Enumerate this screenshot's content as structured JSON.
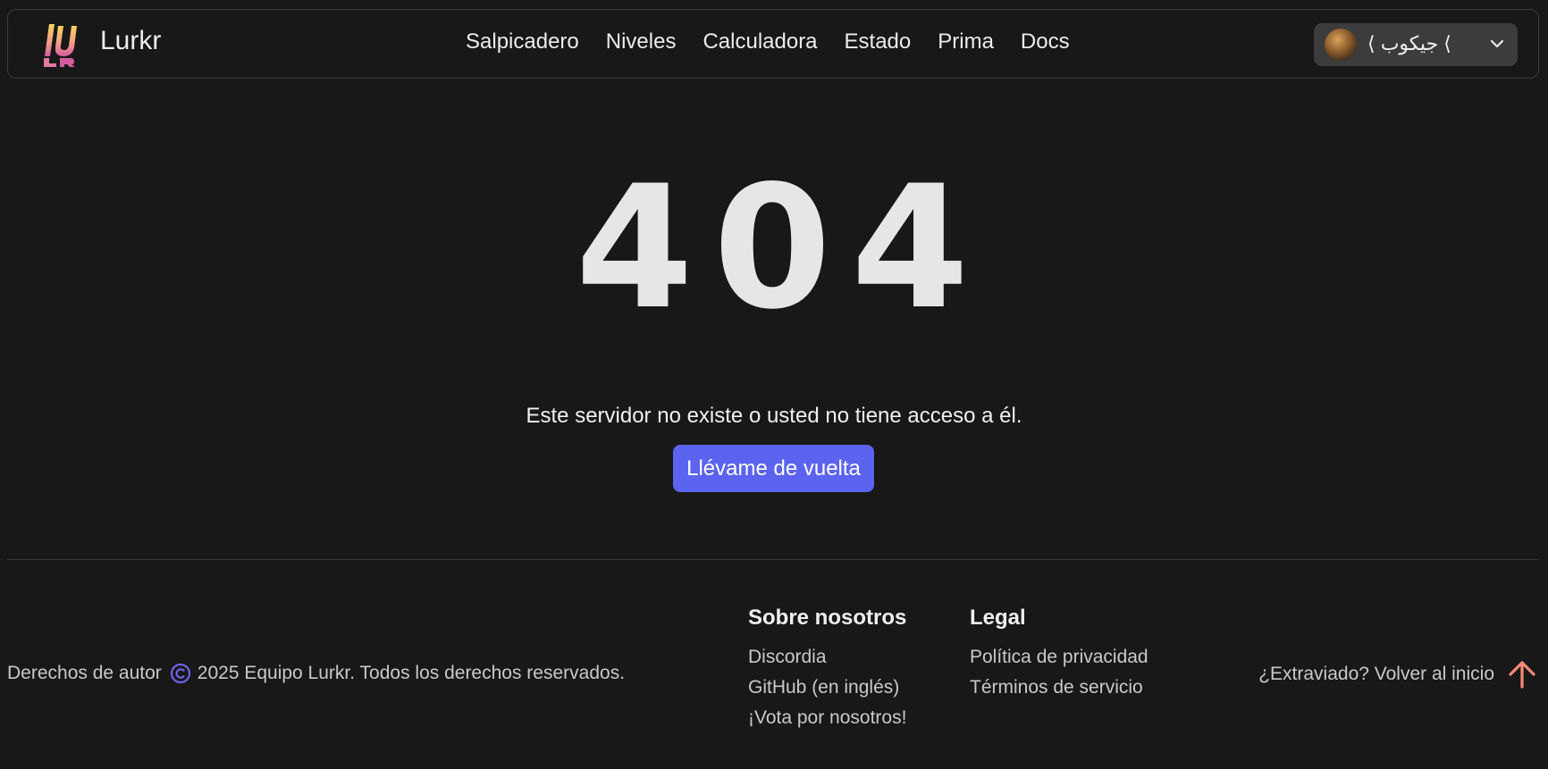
{
  "header": {
    "brand": "Lurkr",
    "nav": [
      "Salpicadero",
      "Niveles",
      "Calculadora",
      "Estado",
      "Prima",
      "Docs"
    ],
    "user": {
      "name": "⟨ جيكوب ⟨",
      "avatar_icon": "user-avatar",
      "menu_icon": "chevron-down-icon"
    }
  },
  "error": {
    "code": "404",
    "message": "Este servidor no existe o usted no tiene acceso a él.",
    "button": "Llévame de vuelta",
    "button_color": "#5b63f0"
  },
  "footer": {
    "copyright_prefix": "Derechos de autor",
    "copyright_suffix": "2025 Equipo Lurkr. Todos los derechos reservados.",
    "about": {
      "title": "Sobre nosotros",
      "links": [
        "Discordia",
        "GitHub (en inglés)",
        "¡Vota por nosotros!"
      ]
    },
    "legal": {
      "title": "Legal",
      "links": [
        "Política de privacidad",
        "Términos de servicio"
      ]
    },
    "back_to_top": "¿Extraviado? Volver al inicio",
    "back_to_top_color": "#ff8a7a"
  }
}
